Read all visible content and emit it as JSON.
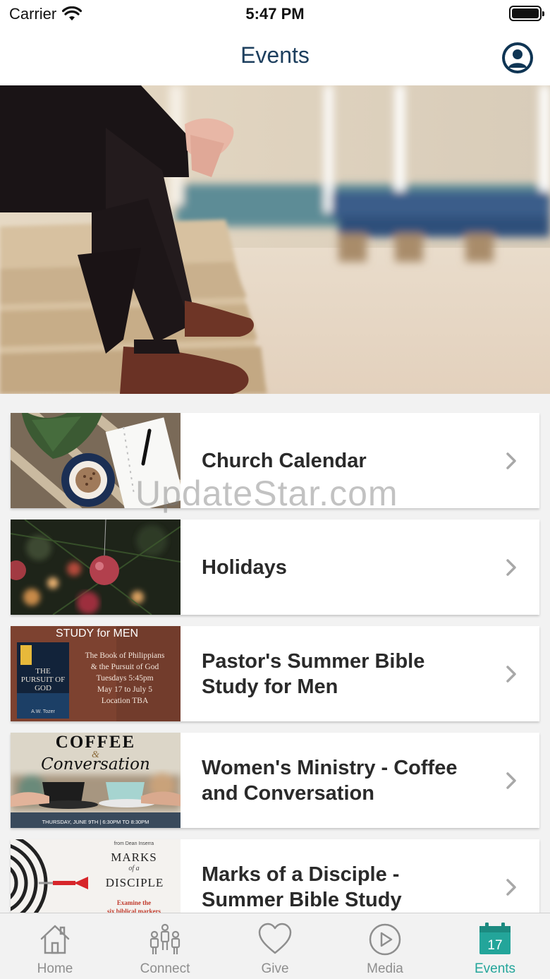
{
  "status": {
    "carrier": "Carrier",
    "time": "5:47 PM"
  },
  "header": {
    "title": "Events"
  },
  "events": [
    {
      "title": "Church Calendar"
    },
    {
      "title": "Holidays"
    },
    {
      "title": "Pastor's Summer Bible Study for Men",
      "thumb": {
        "heading": "STUDY for MEN",
        "book_title": "THE PURSUIT OF GOD",
        "author": "A.W. Tozer",
        "lines": [
          "The Book of Philippians",
          "& the Pursuit of God",
          "Tuesdays 5:45pm",
          "May 17 to July 5",
          "Location TBA"
        ]
      }
    },
    {
      "title": "Women's Ministry - Coffee and Conversation",
      "thumb": {
        "word1": "COFFEE",
        "amp": "&",
        "word2": "Conversation",
        "date": "THURSDAY, JUNE 9TH | 6:30PM TO 8:30PM"
      }
    },
    {
      "title": "Marks of a Disciple - Summer Bible Study",
      "thumb": {
        "top": "from Dean Inserra",
        "t1": "MARKS",
        "t2": "of a",
        "t3": "DISCIPLE",
        "sub": "Examine the",
        "sub2": "six biblical markers"
      }
    }
  ],
  "watermark": "UpdateStar.com",
  "tabs": [
    {
      "label": "Home",
      "icon": "home-icon"
    },
    {
      "label": "Connect",
      "icon": "people-icon"
    },
    {
      "label": "Give",
      "icon": "heart-icon"
    },
    {
      "label": "Media",
      "icon": "play-icon"
    },
    {
      "label": "Events",
      "icon": "calendar-icon",
      "day": "17",
      "active": true
    }
  ],
  "colors": {
    "title": "#1d3f5e",
    "profile": "#0f3554",
    "active_tab": "#23a59a",
    "inactive_tab": "#8e8e8e"
  }
}
